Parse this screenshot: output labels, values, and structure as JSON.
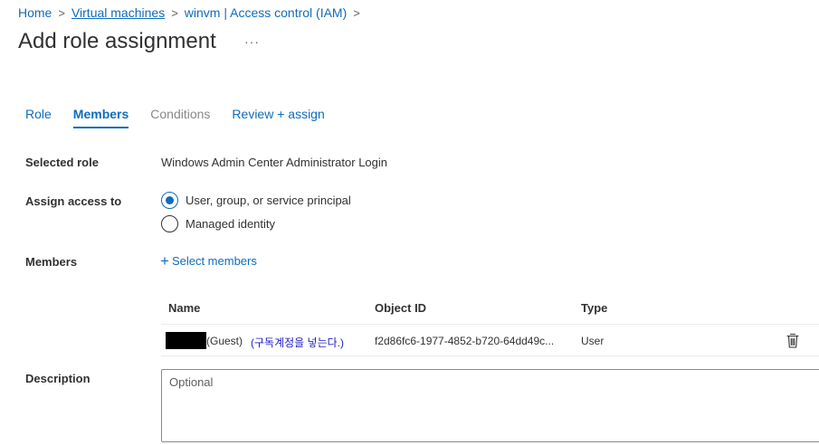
{
  "breadcrumb": {
    "items": [
      "Home",
      "Virtual machines",
      "winvm | Access control (IAM)"
    ],
    "separator": ">"
  },
  "page": {
    "title": "Add role assignment",
    "more_label": "···"
  },
  "tabs": [
    {
      "label": "Role",
      "state": "normal"
    },
    {
      "label": "Members",
      "state": "active"
    },
    {
      "label": "Conditions",
      "state": "disabled"
    },
    {
      "label": "Review + assign",
      "state": "normal"
    }
  ],
  "form": {
    "selected_role_label": "Selected role",
    "selected_role_value": "Windows Admin Center Administrator Login",
    "assign_access_label": "Assign access to",
    "assign_options": [
      {
        "label": "User, group, or service principal",
        "checked": true
      },
      {
        "label": "Managed identity",
        "checked": false
      }
    ],
    "members_label": "Members",
    "select_members_label": "Select members",
    "description_label": "Description",
    "description_placeholder": "Optional"
  },
  "members_table": {
    "columns": [
      "Name",
      "Object ID",
      "Type"
    ],
    "rows": [
      {
        "name_suffix": "(Guest)",
        "annotation": "(구독계정을 넣는다.)",
        "object_id": "f2d86fc6-1977-4852-b720-64dd49c...",
        "type": "User",
        "delete_icon": "trash-icon"
      }
    ]
  },
  "colors": {
    "accent": "#0f6cbd",
    "text": "#323130",
    "disabled": "#8a8886",
    "annotation": "#2020c0"
  }
}
